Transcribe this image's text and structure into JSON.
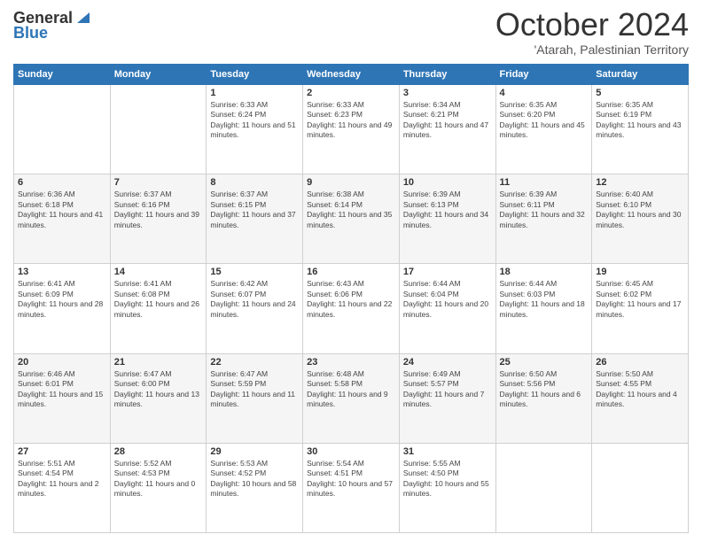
{
  "logo": {
    "general": "General",
    "blue": "Blue"
  },
  "header": {
    "month": "October 2024",
    "location": "'Atarah, Palestinian Territory"
  },
  "days_header": [
    "Sunday",
    "Monday",
    "Tuesday",
    "Wednesday",
    "Thursday",
    "Friday",
    "Saturday"
  ],
  "weeks": [
    [
      {
        "day": "",
        "sunrise": "",
        "sunset": "",
        "daylight": ""
      },
      {
        "day": "",
        "sunrise": "",
        "sunset": "",
        "daylight": ""
      },
      {
        "day": "1",
        "sunrise": "Sunrise: 6:33 AM",
        "sunset": "Sunset: 6:24 PM",
        "daylight": "Daylight: 11 hours and 51 minutes."
      },
      {
        "day": "2",
        "sunrise": "Sunrise: 6:33 AM",
        "sunset": "Sunset: 6:23 PM",
        "daylight": "Daylight: 11 hours and 49 minutes."
      },
      {
        "day": "3",
        "sunrise": "Sunrise: 6:34 AM",
        "sunset": "Sunset: 6:21 PM",
        "daylight": "Daylight: 11 hours and 47 minutes."
      },
      {
        "day": "4",
        "sunrise": "Sunrise: 6:35 AM",
        "sunset": "Sunset: 6:20 PM",
        "daylight": "Daylight: 11 hours and 45 minutes."
      },
      {
        "day": "5",
        "sunrise": "Sunrise: 6:35 AM",
        "sunset": "Sunset: 6:19 PM",
        "daylight": "Daylight: 11 hours and 43 minutes."
      }
    ],
    [
      {
        "day": "6",
        "sunrise": "Sunrise: 6:36 AM",
        "sunset": "Sunset: 6:18 PM",
        "daylight": "Daylight: 11 hours and 41 minutes."
      },
      {
        "day": "7",
        "sunrise": "Sunrise: 6:37 AM",
        "sunset": "Sunset: 6:16 PM",
        "daylight": "Daylight: 11 hours and 39 minutes."
      },
      {
        "day": "8",
        "sunrise": "Sunrise: 6:37 AM",
        "sunset": "Sunset: 6:15 PM",
        "daylight": "Daylight: 11 hours and 37 minutes."
      },
      {
        "day": "9",
        "sunrise": "Sunrise: 6:38 AM",
        "sunset": "Sunset: 6:14 PM",
        "daylight": "Daylight: 11 hours and 35 minutes."
      },
      {
        "day": "10",
        "sunrise": "Sunrise: 6:39 AM",
        "sunset": "Sunset: 6:13 PM",
        "daylight": "Daylight: 11 hours and 34 minutes."
      },
      {
        "day": "11",
        "sunrise": "Sunrise: 6:39 AM",
        "sunset": "Sunset: 6:11 PM",
        "daylight": "Daylight: 11 hours and 32 minutes."
      },
      {
        "day": "12",
        "sunrise": "Sunrise: 6:40 AM",
        "sunset": "Sunset: 6:10 PM",
        "daylight": "Daylight: 11 hours and 30 minutes."
      }
    ],
    [
      {
        "day": "13",
        "sunrise": "Sunrise: 6:41 AM",
        "sunset": "Sunset: 6:09 PM",
        "daylight": "Daylight: 11 hours and 28 minutes."
      },
      {
        "day": "14",
        "sunrise": "Sunrise: 6:41 AM",
        "sunset": "Sunset: 6:08 PM",
        "daylight": "Daylight: 11 hours and 26 minutes."
      },
      {
        "day": "15",
        "sunrise": "Sunrise: 6:42 AM",
        "sunset": "Sunset: 6:07 PM",
        "daylight": "Daylight: 11 hours and 24 minutes."
      },
      {
        "day": "16",
        "sunrise": "Sunrise: 6:43 AM",
        "sunset": "Sunset: 6:06 PM",
        "daylight": "Daylight: 11 hours and 22 minutes."
      },
      {
        "day": "17",
        "sunrise": "Sunrise: 6:44 AM",
        "sunset": "Sunset: 6:04 PM",
        "daylight": "Daylight: 11 hours and 20 minutes."
      },
      {
        "day": "18",
        "sunrise": "Sunrise: 6:44 AM",
        "sunset": "Sunset: 6:03 PM",
        "daylight": "Daylight: 11 hours and 18 minutes."
      },
      {
        "day": "19",
        "sunrise": "Sunrise: 6:45 AM",
        "sunset": "Sunset: 6:02 PM",
        "daylight": "Daylight: 11 hours and 17 minutes."
      }
    ],
    [
      {
        "day": "20",
        "sunrise": "Sunrise: 6:46 AM",
        "sunset": "Sunset: 6:01 PM",
        "daylight": "Daylight: 11 hours and 15 minutes."
      },
      {
        "day": "21",
        "sunrise": "Sunrise: 6:47 AM",
        "sunset": "Sunset: 6:00 PM",
        "daylight": "Daylight: 11 hours and 13 minutes."
      },
      {
        "day": "22",
        "sunrise": "Sunrise: 6:47 AM",
        "sunset": "Sunset: 5:59 PM",
        "daylight": "Daylight: 11 hours and 11 minutes."
      },
      {
        "day": "23",
        "sunrise": "Sunrise: 6:48 AM",
        "sunset": "Sunset: 5:58 PM",
        "daylight": "Daylight: 11 hours and 9 minutes."
      },
      {
        "day": "24",
        "sunrise": "Sunrise: 6:49 AM",
        "sunset": "Sunset: 5:57 PM",
        "daylight": "Daylight: 11 hours and 7 minutes."
      },
      {
        "day": "25",
        "sunrise": "Sunrise: 6:50 AM",
        "sunset": "Sunset: 5:56 PM",
        "daylight": "Daylight: 11 hours and 6 minutes."
      },
      {
        "day": "26",
        "sunrise": "Sunrise: 5:50 AM",
        "sunset": "Sunset: 4:55 PM",
        "daylight": "Daylight: 11 hours and 4 minutes."
      }
    ],
    [
      {
        "day": "27",
        "sunrise": "Sunrise: 5:51 AM",
        "sunset": "Sunset: 4:54 PM",
        "daylight": "Daylight: 11 hours and 2 minutes."
      },
      {
        "day": "28",
        "sunrise": "Sunrise: 5:52 AM",
        "sunset": "Sunset: 4:53 PM",
        "daylight": "Daylight: 11 hours and 0 minutes."
      },
      {
        "day": "29",
        "sunrise": "Sunrise: 5:53 AM",
        "sunset": "Sunset: 4:52 PM",
        "daylight": "Daylight: 10 hours and 58 minutes."
      },
      {
        "day": "30",
        "sunrise": "Sunrise: 5:54 AM",
        "sunset": "Sunset: 4:51 PM",
        "daylight": "Daylight: 10 hours and 57 minutes."
      },
      {
        "day": "31",
        "sunrise": "Sunrise: 5:55 AM",
        "sunset": "Sunset: 4:50 PM",
        "daylight": "Daylight: 10 hours and 55 minutes."
      },
      {
        "day": "",
        "sunrise": "",
        "sunset": "",
        "daylight": ""
      },
      {
        "day": "",
        "sunrise": "",
        "sunset": "",
        "daylight": ""
      }
    ]
  ]
}
